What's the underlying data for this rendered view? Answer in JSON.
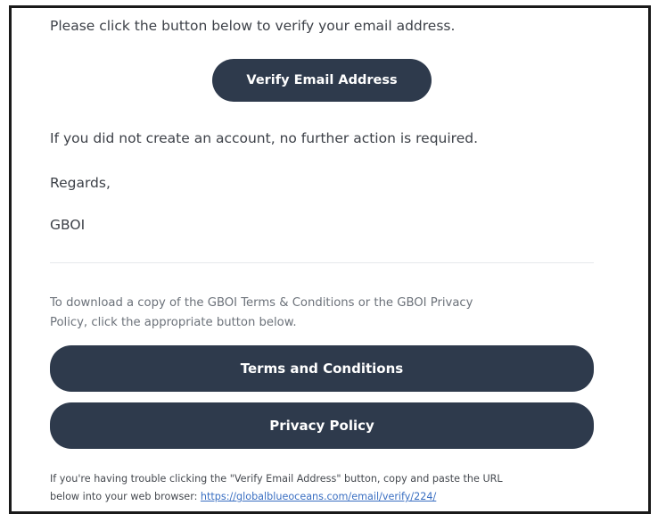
{
  "email": {
    "intro_text": "Please click the button below to verify your email address.",
    "verify_button_label": "Verify Email Address",
    "no_action_text": "If you did not create an account, no further action is required.",
    "regards_text": "Regards,",
    "signature_text": "GBOI",
    "download_text_line1": "To download a copy of the GBOI Terms & Conditions or the GBOI Privacy",
    "download_text_line2": "Policy, click the appropriate button below.",
    "terms_button_label": "Terms and Conditions",
    "privacy_button_label": "Privacy Policy",
    "trouble_text_line1": "If you're having trouble clicking the \"Verify Email Address\" button, copy and paste the URL",
    "trouble_text_line2_prefix": "below into your web browser: ",
    "verify_url": "https://globalblueoceans.com/email/verify/224/"
  },
  "colors": {
    "button_background": "#2e3a4c",
    "button_text": "#ffffff",
    "link": "#3a6fc2",
    "body_text": "#3d4148",
    "muted_text": "#6c727a",
    "frame_border": "#1a1a1a"
  }
}
